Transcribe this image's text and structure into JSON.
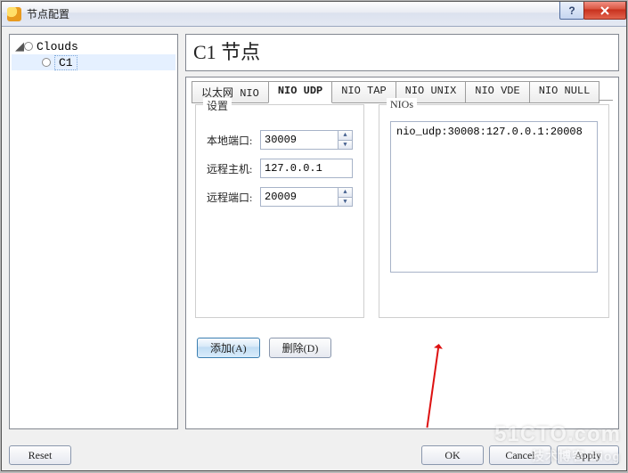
{
  "window": {
    "title": "节点配置"
  },
  "tree": {
    "root": "Clouds",
    "child": "C1"
  },
  "panel": {
    "title": "C1 节点"
  },
  "tabs": [
    {
      "label": "以太网 NIO"
    },
    {
      "label": "NIO UDP"
    },
    {
      "label": "NIO TAP"
    },
    {
      "label": "NIO UNIX"
    },
    {
      "label": "NIO VDE"
    },
    {
      "label": "NIO NULL"
    }
  ],
  "settings": {
    "legend": "设置",
    "local_port_label": "本地端口:",
    "local_port_value": "30009",
    "remote_host_label": "远程主机:",
    "remote_host_value": "127.0.0.1",
    "remote_port_label": "远程端口:",
    "remote_port_value": "20009",
    "add_label": "添加(A)",
    "delete_label": "删除(D)"
  },
  "nios": {
    "legend": "NIOs",
    "items": [
      "nio_udp:30008:127.0.0.1:20008"
    ]
  },
  "footer": {
    "reset": "Reset",
    "ok": "OK",
    "cancel": "Cancel",
    "apply": "Apply"
  },
  "watermark": {
    "line1": "51CTO.com",
    "line2": "技术博客 Blog"
  }
}
